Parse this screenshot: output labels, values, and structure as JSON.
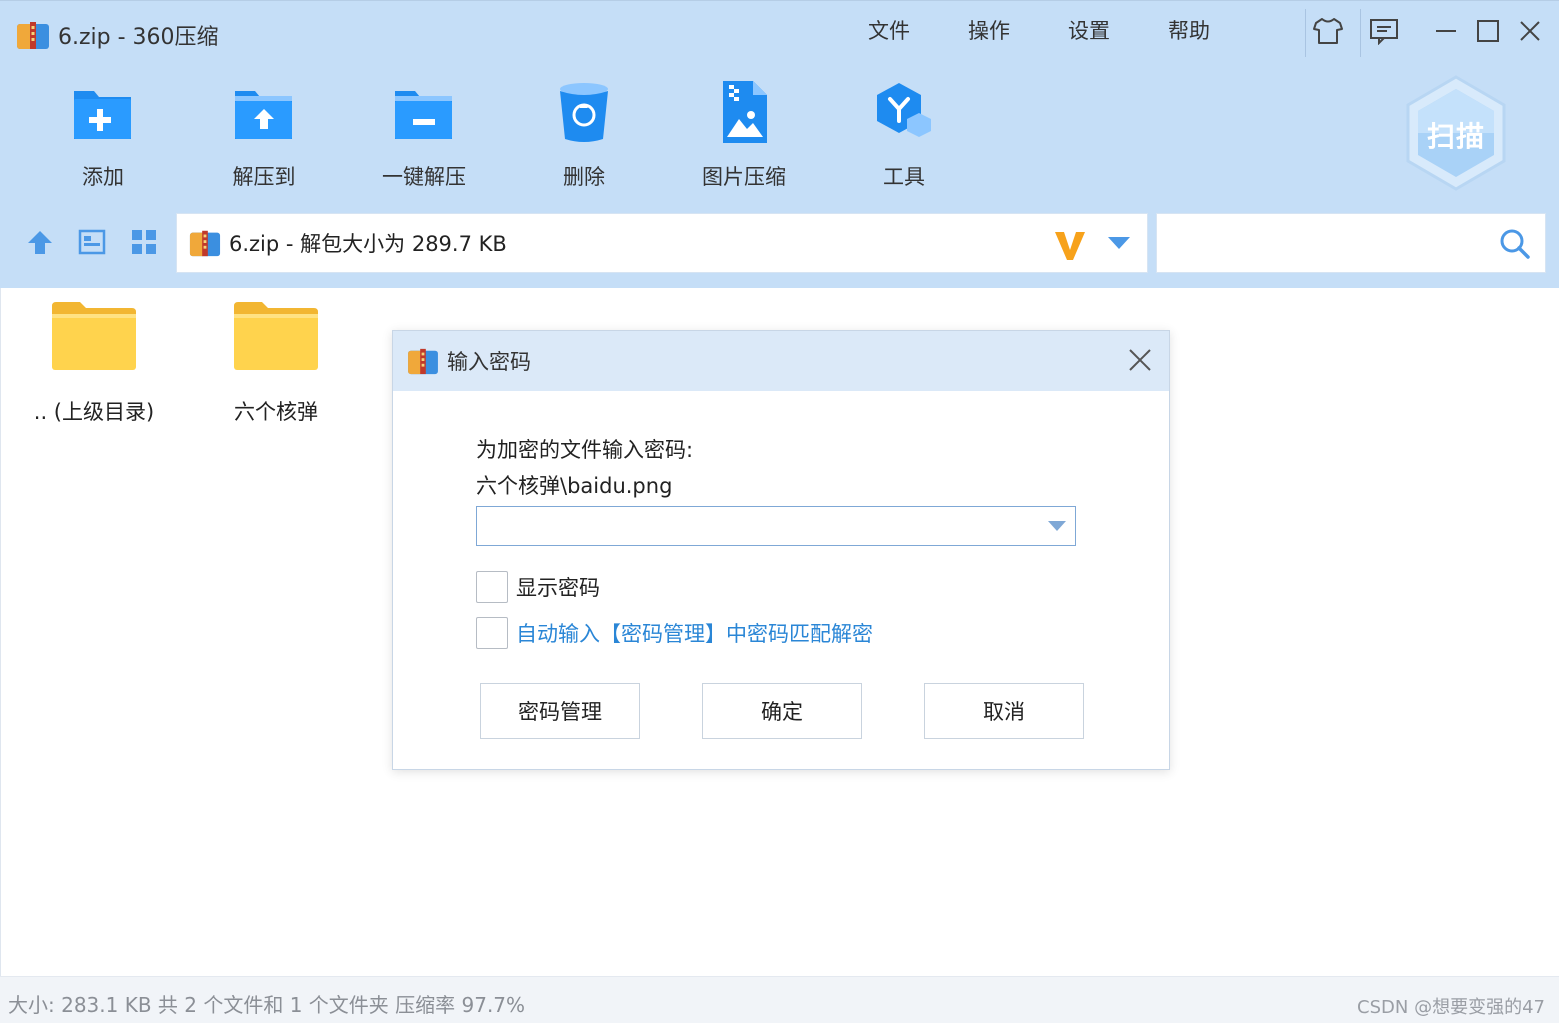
{
  "window": {
    "title": "6.zip - 360压缩",
    "menu": [
      "文件",
      "操作",
      "设置",
      "帮助"
    ],
    "controls": [
      "skin-icon",
      "feedback-icon",
      "minimize-icon",
      "maximize-icon",
      "close-icon"
    ]
  },
  "toolbar": {
    "items": [
      {
        "label": "添加",
        "icon": "add-folder-icon"
      },
      {
        "label": "解压到",
        "icon": "extract-to-icon"
      },
      {
        "label": "一键解压",
        "icon": "one-click-extract-icon"
      },
      {
        "label": "删除",
        "icon": "delete-icon"
      },
      {
        "label": "图片压缩",
        "icon": "image-compress-icon"
      },
      {
        "label": "工具",
        "icon": "tools-icon"
      }
    ],
    "scan_label": "扫描"
  },
  "navbar": {
    "path_text": "6.zip - 解包大小为 289.7 KB",
    "search_placeholder": ""
  },
  "files": [
    {
      "name": ".. (上级目录)",
      "icon": "folder-icon"
    },
    {
      "name": "六个核弹",
      "icon": "folder-icon"
    }
  ],
  "status": {
    "text": "大小: 283.1 KB 共 2 个文件和 1 个文件夹 压缩率 97.7%",
    "watermark": "CSDN @想要变强的47"
  },
  "dialog": {
    "title": "输入密码",
    "prompt": "为加密的文件输入密码:",
    "filename": "六个核弹\\baidu.png",
    "password_value": "",
    "show_password_label": "显示密码",
    "auto_input_label": "自动输入【密码管理】中密码匹配解密",
    "buttons": {
      "manage": "密码管理",
      "ok": "确定",
      "cancel": "取消"
    }
  },
  "colors": {
    "header_bg": "#c5def7",
    "accent_blue": "#1e8bf0",
    "link_blue": "#2a86d6",
    "folder_yellow": "#ffd34d",
    "vip_orange": "#f7a21b"
  }
}
